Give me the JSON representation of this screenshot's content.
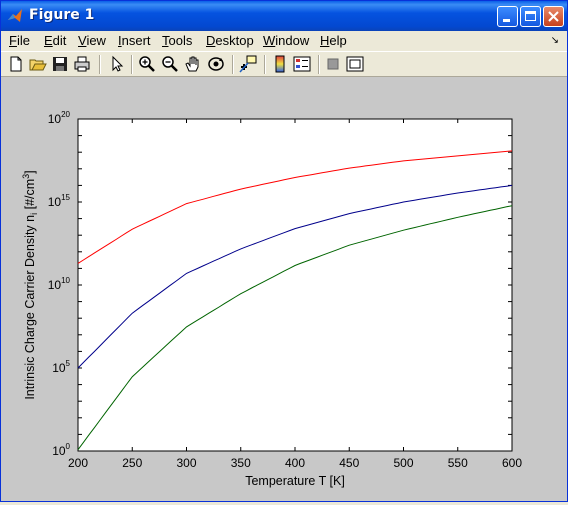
{
  "window": {
    "title": "Figure 1",
    "accent": "#0553e0"
  },
  "menubar": {
    "items": [
      {
        "label": "File",
        "key": "F",
        "rest": "ile"
      },
      {
        "label": "Edit",
        "key": "E",
        "rest": "dit"
      },
      {
        "label": "View",
        "key": "V",
        "rest": "iew"
      },
      {
        "label": "Insert",
        "key": "I",
        "rest": "nsert"
      },
      {
        "label": "Tools",
        "key": "T",
        "rest": "ools"
      },
      {
        "label": "Desktop",
        "key": "D",
        "rest": "esktop"
      },
      {
        "label": "Window",
        "key": "W",
        "rest": "indow"
      },
      {
        "label": "Help",
        "key": "H",
        "rest": "elp"
      }
    ],
    "overflow_arrow": "↘"
  },
  "toolbar": {
    "icons": [
      "new-file-icon",
      "open-file-icon",
      "save-icon",
      "print-icon",
      "pointer-icon",
      "zoom-in-icon",
      "zoom-out-icon",
      "pan-hand-icon",
      "rotate-3d-icon",
      "data-cursor-icon",
      "colorbar-icon",
      "legend-icon",
      "hide-plot-tools-icon",
      "show-plot-tools-icon"
    ]
  },
  "chart_data": {
    "type": "line",
    "xlabel": "Temperature T [K]",
    "ylabel": "Intrinsic Charge Carrier Density n",
    "ylabel_sub": "i",
    "ylabel_unit": " [#/cm",
    "ylabel_unit_sup": "3",
    "ylabel_unit_end": "]",
    "xlim": [
      200,
      600
    ],
    "ylim": [
      1,
      1e+20
    ],
    "yscale": "log",
    "x_ticks": [
      200,
      250,
      300,
      350,
      400,
      450,
      500,
      550,
      600
    ],
    "y_ticks": [
      {
        "base": "10",
        "exp": "0",
        "value": 1
      },
      {
        "base": "10",
        "exp": "5",
        "value": 100000.0
      },
      {
        "base": "10",
        "exp": "10",
        "value": 10000000000.0
      },
      {
        "base": "10",
        "exp": "15",
        "value": 1000000000000000.0
      },
      {
        "base": "10",
        "exp": "20",
        "value": 1e+20
      }
    ],
    "grid": false,
    "series": [
      {
        "color": "#ff0000",
        "x": [
          200,
          250,
          300,
          350,
          400,
          450,
          500,
          550,
          600
        ],
        "y": [
          200000000000.0,
          23000000000000.0,
          800000000000000.0,
          6000000000000000.0,
          3e+16,
          1.1e+17,
          3e+17,
          6e+17,
          1.2e+18
        ]
      },
      {
        "color": "#00008b",
        "x": [
          200,
          250,
          300,
          350,
          400,
          450,
          500,
          550,
          600
        ],
        "y": [
          100000.0,
          200000000.0,
          50000000000.0,
          1500000000000.0,
          25000000000000.0,
          200000000000000.0,
          1000000000000000.0,
          3500000000000000.0,
          1e+16
        ]
      },
      {
        "color": "#006400",
        "x": [
          200,
          250,
          300,
          350,
          400,
          450,
          500,
          550,
          600
        ],
        "y": [
          1.2,
          30000.0,
          30000000.0,
          3000000000.0,
          150000000000.0,
          2500000000000.0,
          20000000000000.0,
          120000000000000.0,
          600000000000000.0
        ]
      }
    ]
  }
}
